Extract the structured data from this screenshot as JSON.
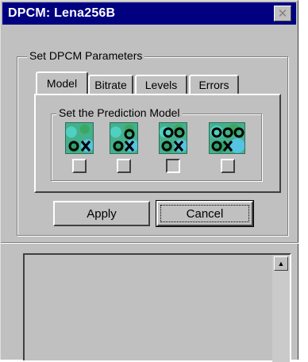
{
  "window": {
    "title": "DPCM: Lena256B",
    "close_icon": "close-icon",
    "close_glyph": "✕"
  },
  "parameters_group": {
    "label": "Set DPCM Parameters",
    "tabs": [
      {
        "label": "Model",
        "active": true
      },
      {
        "label": "Bitrate",
        "active": false
      },
      {
        "label": "Levels",
        "active": false
      },
      {
        "label": "Errors",
        "active": false
      }
    ]
  },
  "prediction_group": {
    "label": "Set the Prediction Model",
    "models": [
      {
        "icon": "prediction-model-1-icon",
        "checked": false
      },
      {
        "icon": "prediction-model-2-icon",
        "checked": false
      },
      {
        "icon": "prediction-model-3-icon",
        "checked": false
      },
      {
        "icon": "prediction-model-4-icon",
        "checked": false
      }
    ]
  },
  "buttons": {
    "apply_label": "Apply",
    "cancel_label": "Cancel"
  },
  "scrollbar": {
    "up_glyph": "▲"
  },
  "colors": {
    "title_bar": "#000080",
    "face": "#c0c0c0",
    "icon_teal": "#44b08c"
  }
}
